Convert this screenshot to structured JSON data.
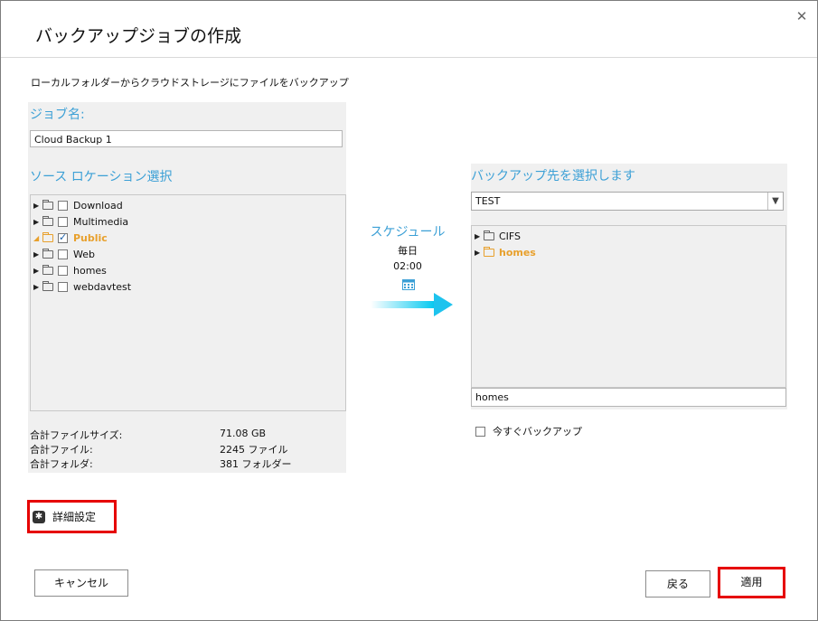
{
  "dialog": {
    "title": "バックアップジョブの作成",
    "subtitle": "ローカルフォルダーからクラウドストレージにファイルをバックアップ",
    "close_glyph": "✕"
  },
  "source": {
    "job_name_label": "ジョブ名:",
    "job_name_value": "Cloud Backup 1",
    "location_label": "ソース ロケーション選択",
    "folders": [
      {
        "name": "Download",
        "checked": false,
        "expanded": false
      },
      {
        "name": "Multimedia",
        "checked": false,
        "expanded": false
      },
      {
        "name": "Public",
        "checked": true,
        "expanded": true
      },
      {
        "name": "Web",
        "checked": false,
        "expanded": false
      },
      {
        "name": "homes",
        "checked": false,
        "expanded": false
      },
      {
        "name": "webdavtest",
        "checked": false,
        "expanded": false
      }
    ],
    "stats": [
      {
        "label": "合計ファイルサイズ:",
        "value": "71.08 GB"
      },
      {
        "label": "合計ファイル:",
        "value": "2245 ファイル"
      },
      {
        "label": "合計フォルダ:",
        "value": "381 フォルダー"
      }
    ]
  },
  "schedule": {
    "title": "スケジュール",
    "frequency": "毎日",
    "time": "02:00",
    "calendar_icon": "calendar-icon"
  },
  "destination": {
    "label": "バックアップ先を選択します",
    "selected": "TEST",
    "folders": [
      {
        "name": "CIFS",
        "highlighted": false
      },
      {
        "name": "homes",
        "highlighted": true
      }
    ],
    "path_value": "homes",
    "backup_now_label": "今すぐバックアップ"
  },
  "footer": {
    "advanced_label": "詳細設定",
    "cancel_label": "キャンセル",
    "back_label": "戻る",
    "apply_label": "適用"
  },
  "colors": {
    "accent_blue": "#3ca0d6",
    "highlight_orange": "#e8a02c",
    "emphasis_red": "#e60000"
  }
}
